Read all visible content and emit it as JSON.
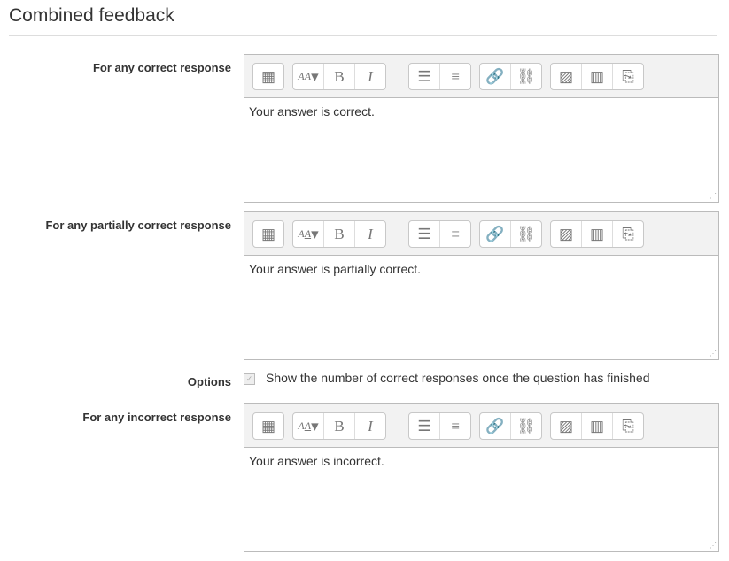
{
  "section_title": "Combined feedback",
  "toolbar_groups": [
    [
      "toolbar-toggle-icon"
    ],
    [
      "font-size-icon",
      "bold-icon",
      "italic-icon"
    ],
    [
      "bullet-list-icon",
      "numbered-list-icon"
    ],
    [
      "link-icon",
      "unlink-icon"
    ],
    [
      "image-icon",
      "media-icon",
      "manage-files-icon"
    ]
  ],
  "editors": [
    {
      "label": "For any correct response",
      "content": "Your answer is correct."
    },
    {
      "label": "For any partially correct response",
      "content": "Your answer is partially correct."
    },
    {
      "label": "For any incorrect response",
      "content": "Your answer is incorrect."
    }
  ],
  "options": {
    "label": "Options",
    "checkbox_label": "Show the number of correct responses once the question has finished",
    "checked": true
  }
}
